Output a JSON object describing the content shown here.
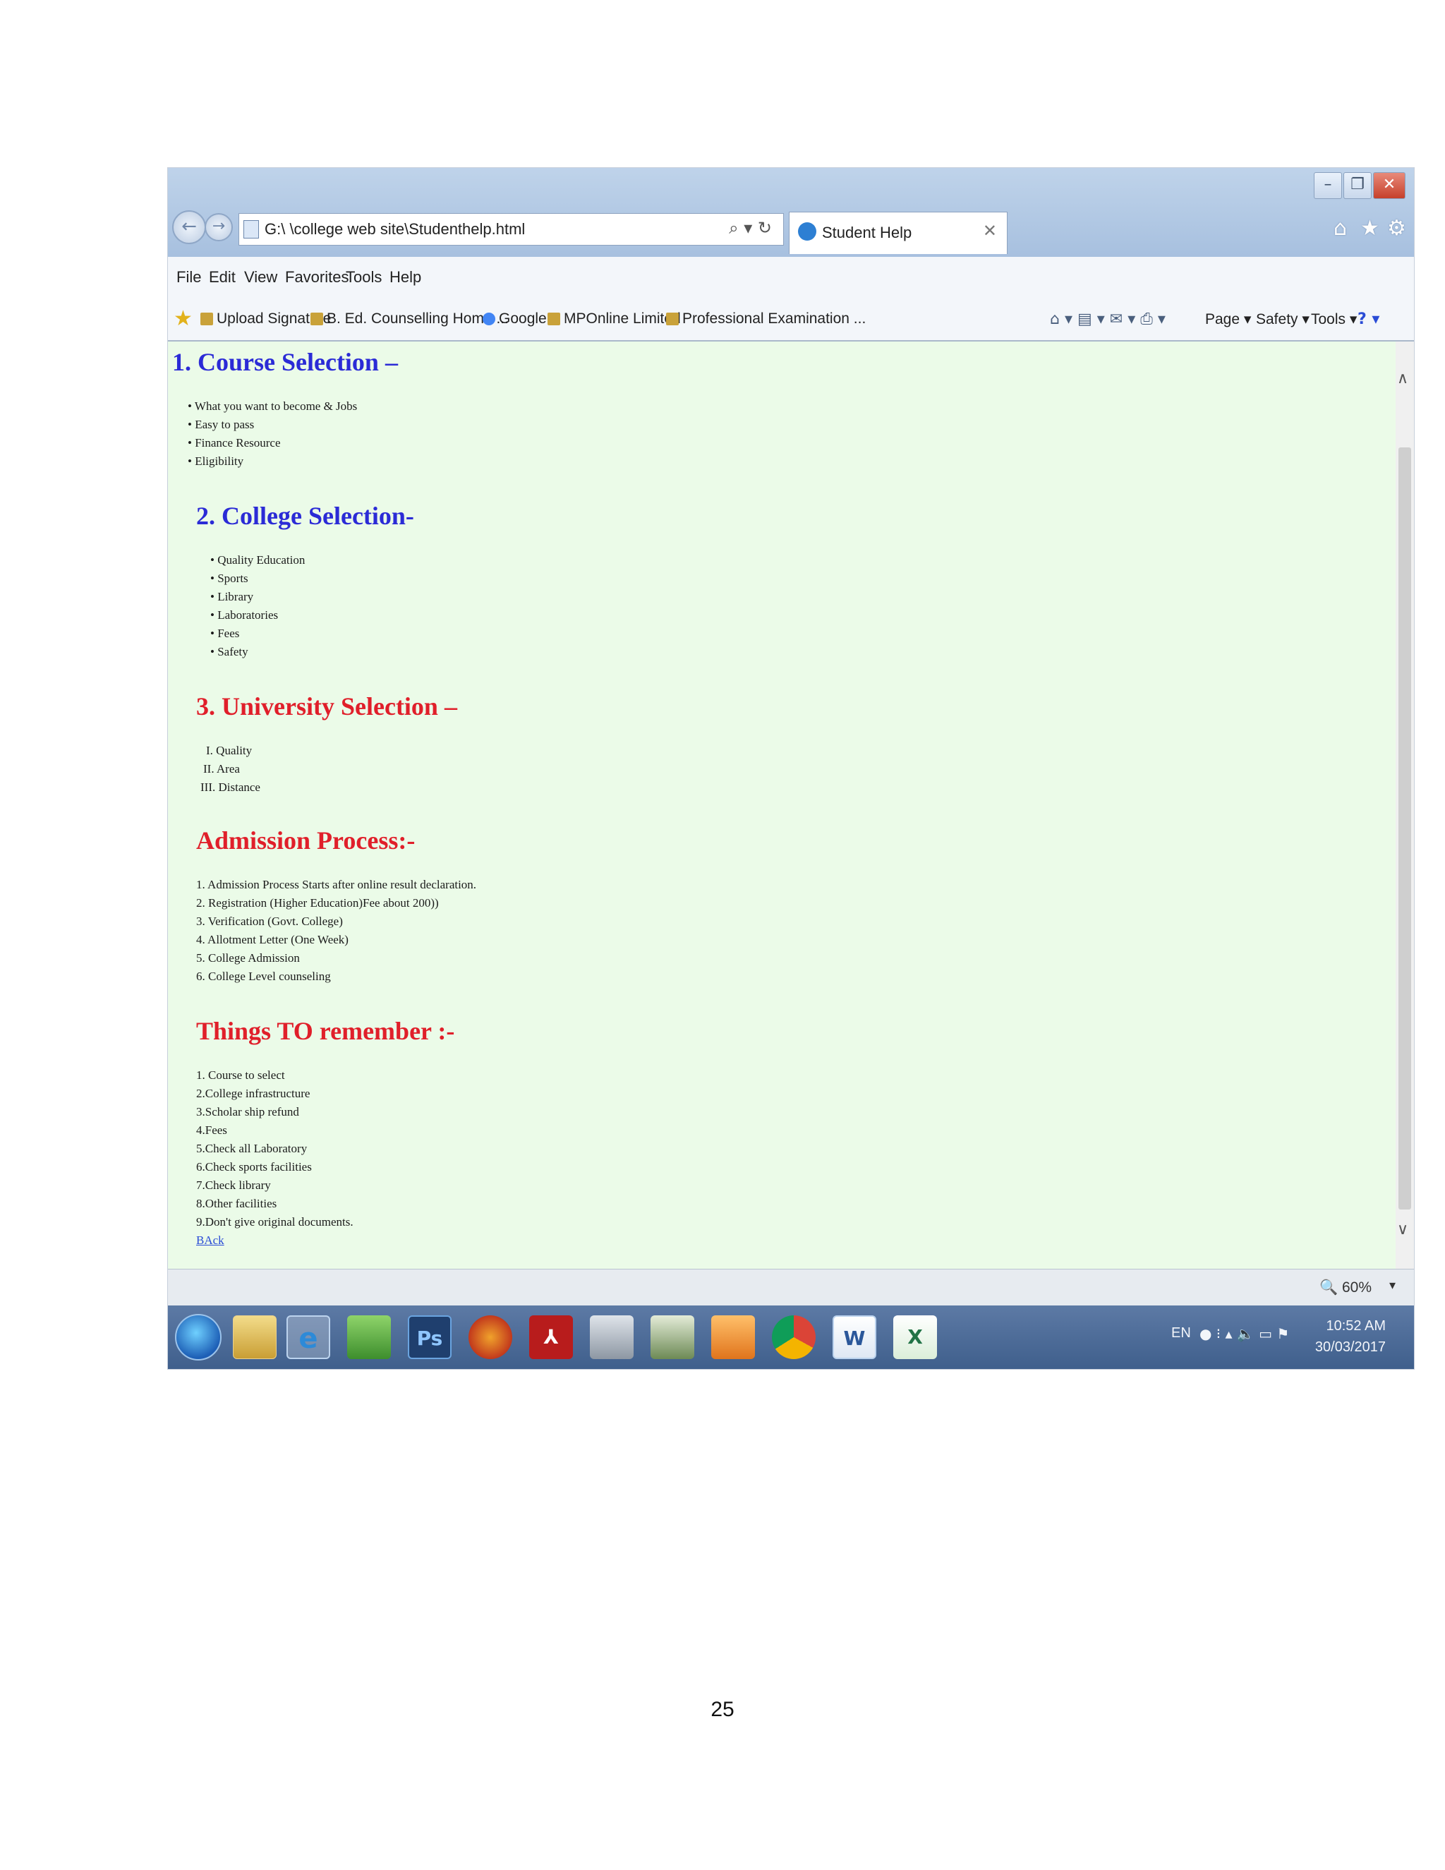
{
  "window": {
    "controls": {
      "minimize": "–",
      "maximize": "❐",
      "close": "✕"
    },
    "nav": {
      "back": "←",
      "forward": "→"
    },
    "address": {
      "url": "G:\\ \\college web site\\Studenthelp.html",
      "search_icon": "⌕ ▾ ↻"
    },
    "tab": {
      "title": "Student Help",
      "close": "✕"
    },
    "toolbar_icons": {
      "home": "⌂",
      "favorites": "★",
      "settings": "⚙"
    }
  },
  "menubar": {
    "items": [
      "File",
      "Edit",
      "View",
      "Favorites",
      "Tools",
      "Help"
    ]
  },
  "favorites_bar": {
    "items": [
      "Upload Signature",
      "B. Ed. Counselling Home ...",
      "Google",
      "MPOnline Limited",
      "Professional Examination ..."
    ],
    "commands": [
      "Page ▾",
      "Safety ▾",
      "Tools ▾"
    ]
  },
  "content": {
    "course": {
      "heading": "1. Course Selection –",
      "items": [
        "• What you want to become & Jobs",
        "• Easy to pass",
        "• Finance Resource",
        "• Eligibility"
      ]
    },
    "college": {
      "heading": "2. College Selection-",
      "items": [
        "• Quality Education",
        "• Sports",
        "• Library",
        "• Laboratories",
        "• Fees",
        "• Safety"
      ]
    },
    "university": {
      "heading": "3. University Selection –",
      "items": [
        "I.  Quality",
        "II.  Area",
        "III.  Distance"
      ]
    },
    "admission": {
      "heading": "Admission Process:-",
      "items": [
        "1. Admission Process Starts after online result declaration.",
        "2. Registration (Higher Education)Fee about 200))",
        "3. Verification (Govt. College)",
        "4. Allotment Letter (One Week)",
        "5. College Admission",
        "6. College Level counseling"
      ]
    },
    "remember": {
      "heading": "Things TO remember :-",
      "items": [
        "1. Course to select",
        "2.College infrastructure",
        "3.Scholar ship refund",
        "4.Fees",
        "5.Check all Laboratory",
        "6.Check sports facilities",
        "7.Check library",
        "8.Other facilities",
        "9.Don't give original documents."
      ],
      "back_link": "BAck"
    }
  },
  "statusbar": {
    "zoom": "🔍 60%",
    "zoom_arrow": "▾"
  },
  "taskbar": {
    "ps_label": "Ps",
    "word_label": "W",
    "excel_label": "X",
    "ie_label": "e",
    "lang": "EN",
    "time": "10:52 AM",
    "date": "30/03/2017"
  },
  "document": {
    "page_number": "25"
  },
  "colors": {
    "heading_blue": "#2b2bd6",
    "heading_red": "#e01f2a",
    "page_background": "#ebfbe8",
    "taskbar": "#4a6a97"
  }
}
